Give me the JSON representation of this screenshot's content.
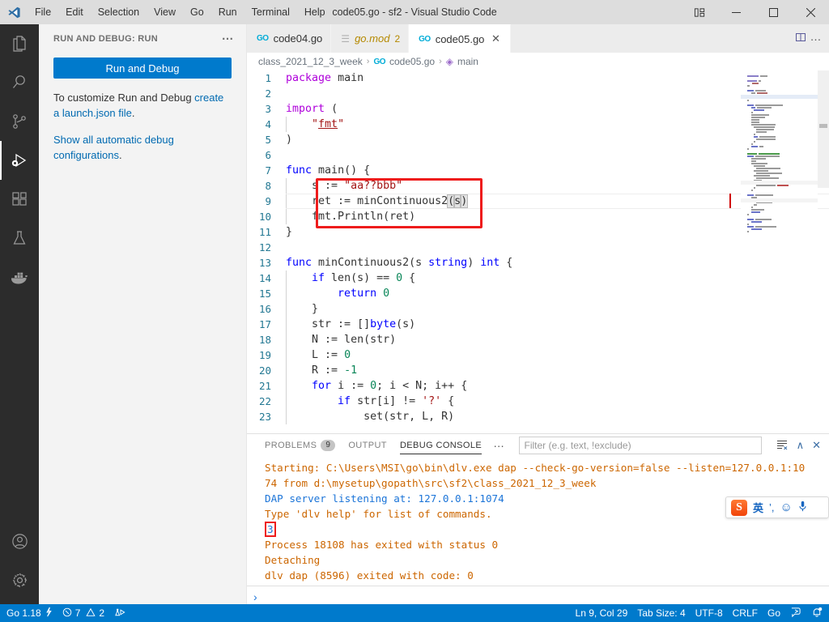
{
  "window": {
    "title": "code05.go - sf2 - Visual Studio Code",
    "minimize": "─",
    "maximize": "☐",
    "close": "✕"
  },
  "menubar": {
    "items": [
      {
        "label": "File"
      },
      {
        "label": "Edit"
      },
      {
        "label": "Selection"
      },
      {
        "label": "View"
      },
      {
        "label": "Go"
      },
      {
        "label": "Run"
      },
      {
        "label": "Terminal"
      },
      {
        "label": "Help"
      }
    ]
  },
  "activitybar": {
    "items": [
      {
        "name": "explorer-icon",
        "title": "Explorer"
      },
      {
        "name": "search-icon",
        "title": "Search"
      },
      {
        "name": "source-control-icon",
        "title": "Source Control"
      },
      {
        "name": "run-and-debug-icon",
        "title": "Run and Debug"
      },
      {
        "name": "extensions-icon",
        "title": "Extensions"
      },
      {
        "name": "testing-icon",
        "title": "Testing"
      },
      {
        "name": "docker-icon",
        "title": "Docker"
      }
    ],
    "bottom": [
      {
        "name": "account-icon",
        "title": "Accounts"
      },
      {
        "name": "settings-gear-icon",
        "title": "Manage"
      }
    ]
  },
  "sidebar": {
    "header": "RUN AND DEBUG: RUN",
    "more_actions": "…",
    "run_button": "Run and Debug",
    "help_line1_pre": "To customize Run and Debug ",
    "help_line1_link": "create a launch.json file",
    "help_line1_post": ".",
    "help_line2_link": "Show all automatic debug configurations",
    "help_line2_post": "."
  },
  "tabs": [
    {
      "label": "code04.go",
      "icon": "go-file-icon",
      "active": false,
      "preview": false,
      "badge": "",
      "closable": false
    },
    {
      "label": "go.mod",
      "icon": "mod-file-icon",
      "active": false,
      "preview": true,
      "badge": "2",
      "closable": false
    },
    {
      "label": "code05.go",
      "icon": "go-file-icon",
      "active": true,
      "preview": false,
      "badge": "",
      "closable": true,
      "close": "✕"
    }
  ],
  "editor_actions": {
    "split_editor": "split-editor-icon",
    "more": "…"
  },
  "breadcrumb": {
    "items": [
      "class_2021_12_3_week",
      "code05.go",
      "main"
    ],
    "separator": "›"
  },
  "code": {
    "lines": [
      {
        "n": 1,
        "text": "package main"
      },
      {
        "n": 2,
        "text": ""
      },
      {
        "n": 3,
        "text": "import ("
      },
      {
        "n": 4,
        "text": "    \"fmt\""
      },
      {
        "n": 5,
        "text": ")"
      },
      {
        "n": 6,
        "text": ""
      },
      {
        "n": 7,
        "text": "func main() {"
      },
      {
        "n": 8,
        "text": "    s := \"aa??bbb\""
      },
      {
        "n": 9,
        "text": "    ret := minContinuous2(s)"
      },
      {
        "n": 10,
        "text": "    fmt.Println(ret)"
      },
      {
        "n": 11,
        "text": "}"
      },
      {
        "n": 12,
        "text": ""
      },
      {
        "n": 13,
        "text": "func minContinuous2(s string) int {"
      },
      {
        "n": 14,
        "text": "    if len(s) == 0 {"
      },
      {
        "n": 15,
        "text": "        return 0"
      },
      {
        "n": 16,
        "text": "    }"
      },
      {
        "n": 17,
        "text": "    str := []byte(s)"
      },
      {
        "n": 18,
        "text": "    N := len(str)"
      },
      {
        "n": 19,
        "text": "    L := 0"
      },
      {
        "n": 20,
        "text": "    R := -1"
      },
      {
        "n": 21,
        "text": "    for i := 0; i < N; i++ {"
      },
      {
        "n": 22,
        "text": "        if str[i] != '?' {"
      },
      {
        "n": 23,
        "text": "            set(str, L, R)"
      }
    ],
    "annotation_box": "red-highlight-box-lines-8-10"
  },
  "panel": {
    "tabs": [
      {
        "label": "PROBLEMS",
        "badge": "9",
        "active": false
      },
      {
        "label": "OUTPUT",
        "badge": "",
        "active": false
      },
      {
        "label": "DEBUG CONSOLE",
        "badge": "",
        "active": true
      }
    ],
    "more": "…",
    "filter_placeholder": "Filter (e.g. text, !exclude)",
    "actions": {
      "clear_console": "clear-console-icon",
      "maximize": "∧",
      "close": "✕"
    },
    "console_lines": [
      {
        "text": "Starting: C:\\Users\\MSI\\go\\bin\\dlv.exe dap --check-go-version=false --listen=127.0.0.1:10",
        "color": "orange"
      },
      {
        "text": "74 from d:\\mysetup\\gopath\\src\\sf2\\class_2021_12_3_week",
        "color": "orange"
      },
      {
        "text": "DAP server listening at: 127.0.0.1:1074",
        "color": "blue"
      },
      {
        "text": "Type 'dlv help' for list of commands.",
        "color": "orange"
      },
      {
        "text": "3",
        "color": "blue",
        "boxed": true
      },
      {
        "text": "Process 18108 has exited with status 0",
        "color": "orange"
      },
      {
        "text": "Detaching",
        "color": "orange"
      },
      {
        "text": "dlv dap (8596) exited with code: 0",
        "color": "orange"
      }
    ],
    "prompt": "›"
  },
  "ime": {
    "logo": "S",
    "mode": "英",
    "punctuation": "’,",
    "emoji": "☺",
    "mic": "mic-icon"
  },
  "statusbar": {
    "left": [
      {
        "name": "go-version",
        "label": "Go 1.18",
        "icon": "lightning-icon"
      },
      {
        "name": "problems",
        "label": "7",
        "label2": "2",
        "icon": "error-icon",
        "icon2": "warning-icon"
      },
      {
        "name": "go-test",
        "label": "",
        "icon": "beaker-run-icon"
      }
    ],
    "right": [
      {
        "name": "cursor-position",
        "label": "Ln 9, Col 29"
      },
      {
        "name": "tab-size",
        "label": "Tab Size: 4"
      },
      {
        "name": "encoding",
        "label": "UTF-8"
      },
      {
        "name": "eol",
        "label": "CRLF"
      },
      {
        "name": "language-mode",
        "label": "Go"
      },
      {
        "name": "feedback",
        "label": "",
        "icon": "feedback-icon"
      },
      {
        "name": "notifications",
        "label": "",
        "icon": "bell-dot-icon"
      }
    ]
  },
  "colors": {
    "accent": "#007acc",
    "titlebar": "#dddddd",
    "activitybar": "#2c2c2c",
    "sidebar": "#f3f3f3",
    "editor": "#ffffff",
    "annotation_red": "#ee1c1c",
    "console_orange": "#cc6600",
    "console_blue": "#1b74d8"
  }
}
